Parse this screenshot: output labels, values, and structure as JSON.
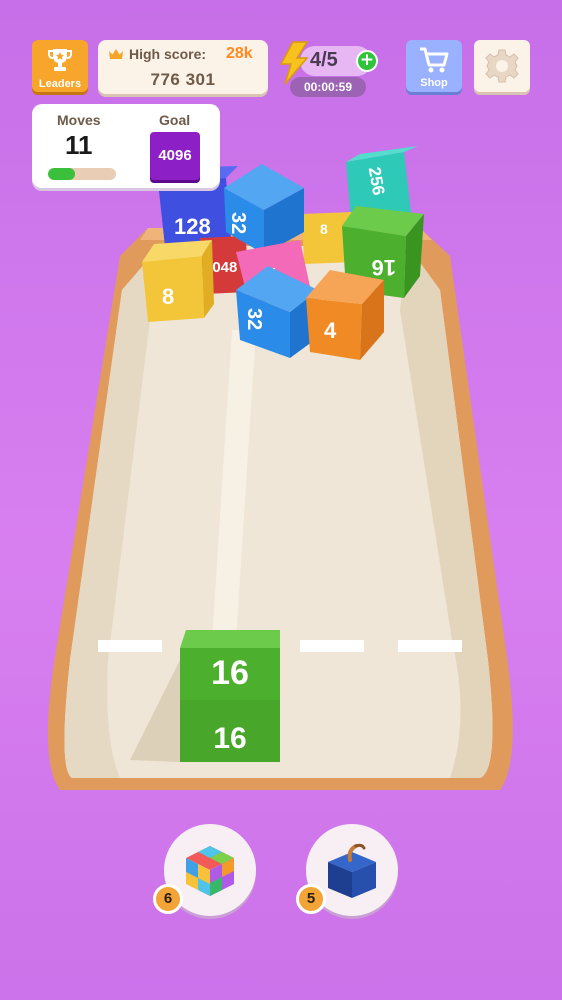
{
  "header": {
    "leaders_label": "Leaders",
    "high_score_label": "High score:",
    "high_score_value": "28k",
    "current_score": "776 301",
    "energy": "4/5",
    "energy_plus": "+",
    "energy_timer": "00:00:59",
    "shop_label": "Shop"
  },
  "goal_panel": {
    "moves_label": "Moves",
    "moves_value": "11",
    "moves_progress": 0.4,
    "goal_label": "Goal",
    "goal_value": "4096"
  },
  "board": {
    "pile_cubes": [
      {
        "value": "128",
        "color": "#3f4fe0"
      },
      {
        "value": "32",
        "color": "#2a8be8"
      },
      {
        "value": "256",
        "color": "#2fc9b8"
      },
      {
        "value": "8",
        "color": "#f3c63a"
      },
      {
        "value": "2048",
        "color": "#d43a3a"
      },
      {
        "value": "4",
        "color": "#f36ab8"
      },
      {
        "value": "8",
        "color": "#f3c63a"
      },
      {
        "value": "32",
        "color": "#2a8be8"
      },
      {
        "value": "16",
        "color": "#4caf2e"
      },
      {
        "value": "4",
        "color": "#f08a25"
      }
    ],
    "player_cube": {
      "value": "16",
      "color": "#4caf2e"
    }
  },
  "boosters": [
    {
      "name": "rainbow-cube",
      "count": "6"
    },
    {
      "name": "bomb-cube",
      "count": "5"
    }
  ],
  "colors": {
    "background": "#d47cee",
    "board_wood": "#e5a061",
    "board_floor": "#efe6d7"
  }
}
